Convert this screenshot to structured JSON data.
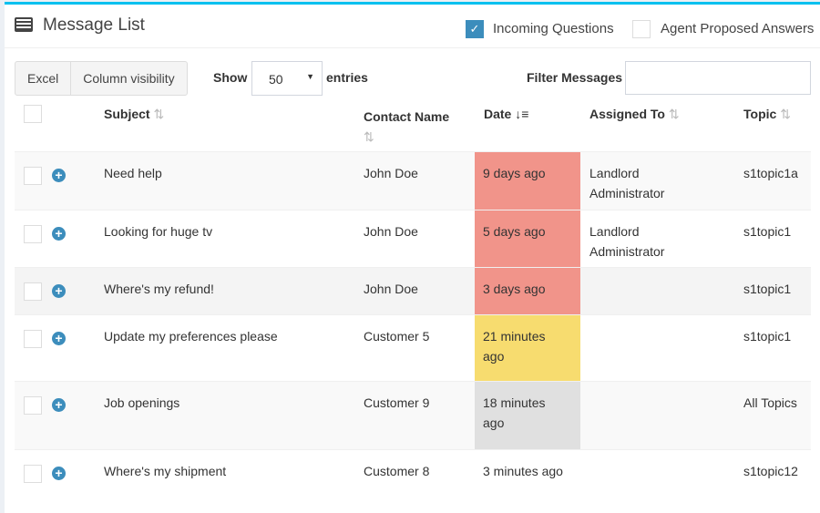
{
  "header": {
    "title": "Message List",
    "icon": "list-alt-icon",
    "filters": [
      {
        "label": "Incoming Questions",
        "checked": true
      },
      {
        "label": "Agent Proposed Answers",
        "checked": false
      }
    ]
  },
  "toolbar": {
    "excel": "Excel",
    "column_visibility": "Column visibility",
    "show": "Show",
    "entries_value": "50",
    "entries": "entries",
    "filter_label": "Filter Messages",
    "filter_value": ""
  },
  "columns": {
    "subject": "Subject",
    "contact": "Contact Name",
    "date": "Date",
    "assigned": "Assigned To",
    "topic": "Topic"
  },
  "colors": {
    "accent": "#00c0ef",
    "old": "#f1948a",
    "recent": "#f7dc6f",
    "neutral": "#e0e0e0"
  },
  "rows": [
    {
      "subject": "Need help",
      "contact": "John Doe",
      "date": "9 days ago",
      "assigned": "Landlord Administrator",
      "topic": "s1topic1a",
      "status": "old"
    },
    {
      "subject": "Looking for huge tv",
      "contact": "John Doe",
      "date": "5 days ago",
      "assigned": "Landlord Administrator",
      "topic": "s1topic1",
      "status": "old"
    },
    {
      "subject": "Where's my refund!",
      "contact": "John Doe",
      "date": "3 days ago",
      "assigned": "",
      "topic": "s1topic1",
      "status": "old"
    },
    {
      "subject": "Update my preferences please",
      "contact": "Customer 5",
      "date": "21 minutes ago",
      "assigned": "",
      "topic": "s1topic1",
      "status": "recent"
    },
    {
      "subject": "Job openings",
      "contact": "Customer 9",
      "date": "18 minutes ago",
      "assigned": "",
      "topic": "All Topics",
      "status": "neutral"
    },
    {
      "subject": "Where's my shipment",
      "contact": "Customer 8",
      "date": "3 minutes ago",
      "assigned": "",
      "topic": "s1topic12",
      "status": "none"
    }
  ]
}
